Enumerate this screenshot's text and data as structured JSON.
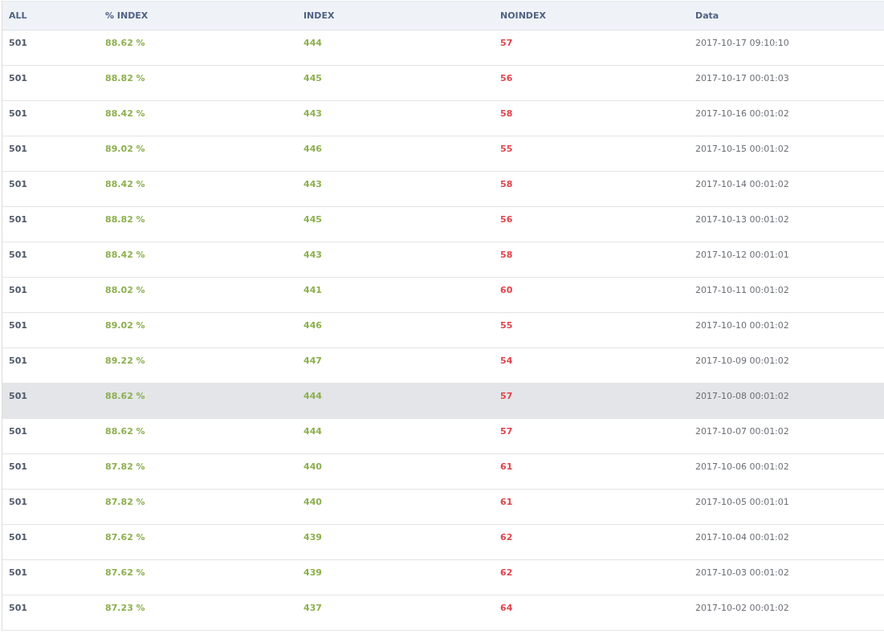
{
  "table": {
    "columns": [
      "ALL",
      "% INDEX",
      "INDEX",
      "NOINDEX",
      "Data"
    ],
    "rows": [
      {
        "all": "501",
        "percent_index": "88.62 %",
        "index": "444",
        "noindex": "57",
        "data": "2017-10-17 09:10:10",
        "highlighted": false
      },
      {
        "all": "501",
        "percent_index": "88.82 %",
        "index": "445",
        "noindex": "56",
        "data": "2017-10-17 00:01:03",
        "highlighted": false
      },
      {
        "all": "501",
        "percent_index": "88.42 %",
        "index": "443",
        "noindex": "58",
        "data": "2017-10-16 00:01:02",
        "highlighted": false
      },
      {
        "all": "501",
        "percent_index": "89.02 %",
        "index": "446",
        "noindex": "55",
        "data": "2017-10-15 00:01:02",
        "highlighted": false
      },
      {
        "all": "501",
        "percent_index": "88.42 %",
        "index": "443",
        "noindex": "58",
        "data": "2017-10-14 00:01:02",
        "highlighted": false
      },
      {
        "all": "501",
        "percent_index": "88.82 %",
        "index": "445",
        "noindex": "56",
        "data": "2017-10-13 00:01:02",
        "highlighted": false
      },
      {
        "all": "501",
        "percent_index": "88.42 %",
        "index": "443",
        "noindex": "58",
        "data": "2017-10-12 00:01:01",
        "highlighted": false
      },
      {
        "all": "501",
        "percent_index": "88.02 %",
        "index": "441",
        "noindex": "60",
        "data": "2017-10-11 00:01:02",
        "highlighted": false
      },
      {
        "all": "501",
        "percent_index": "89.02 %",
        "index": "446",
        "noindex": "55",
        "data": "2017-10-10 00:01:02",
        "highlighted": false
      },
      {
        "all": "501",
        "percent_index": "89.22 %",
        "index": "447",
        "noindex": "54",
        "data": "2017-10-09 00:01:02",
        "highlighted": false
      },
      {
        "all": "501",
        "percent_index": "88.62 %",
        "index": "444",
        "noindex": "57",
        "data": "2017-10-08 00:01:02",
        "highlighted": true
      },
      {
        "all": "501",
        "percent_index": "88.62 %",
        "index": "444",
        "noindex": "57",
        "data": "2017-10-07 00:01:02",
        "highlighted": false
      },
      {
        "all": "501",
        "percent_index": "87.82 %",
        "index": "440",
        "noindex": "61",
        "data": "2017-10-06 00:01:02",
        "highlighted": false
      },
      {
        "all": "501",
        "percent_index": "87.82 %",
        "index": "440",
        "noindex": "61",
        "data": "2017-10-05 00:01:01",
        "highlighted": false
      },
      {
        "all": "501",
        "percent_index": "87.62 %",
        "index": "439",
        "noindex": "62",
        "data": "2017-10-04 00:01:02",
        "highlighted": false
      },
      {
        "all": "501",
        "percent_index": "87.62 %",
        "index": "439",
        "noindex": "62",
        "data": "2017-10-03 00:01:02",
        "highlighted": false
      },
      {
        "all": "501",
        "percent_index": "87.23 %",
        "index": "437",
        "noindex": "64",
        "data": "2017-10-02 00:01:02",
        "highlighted": false
      }
    ]
  }
}
